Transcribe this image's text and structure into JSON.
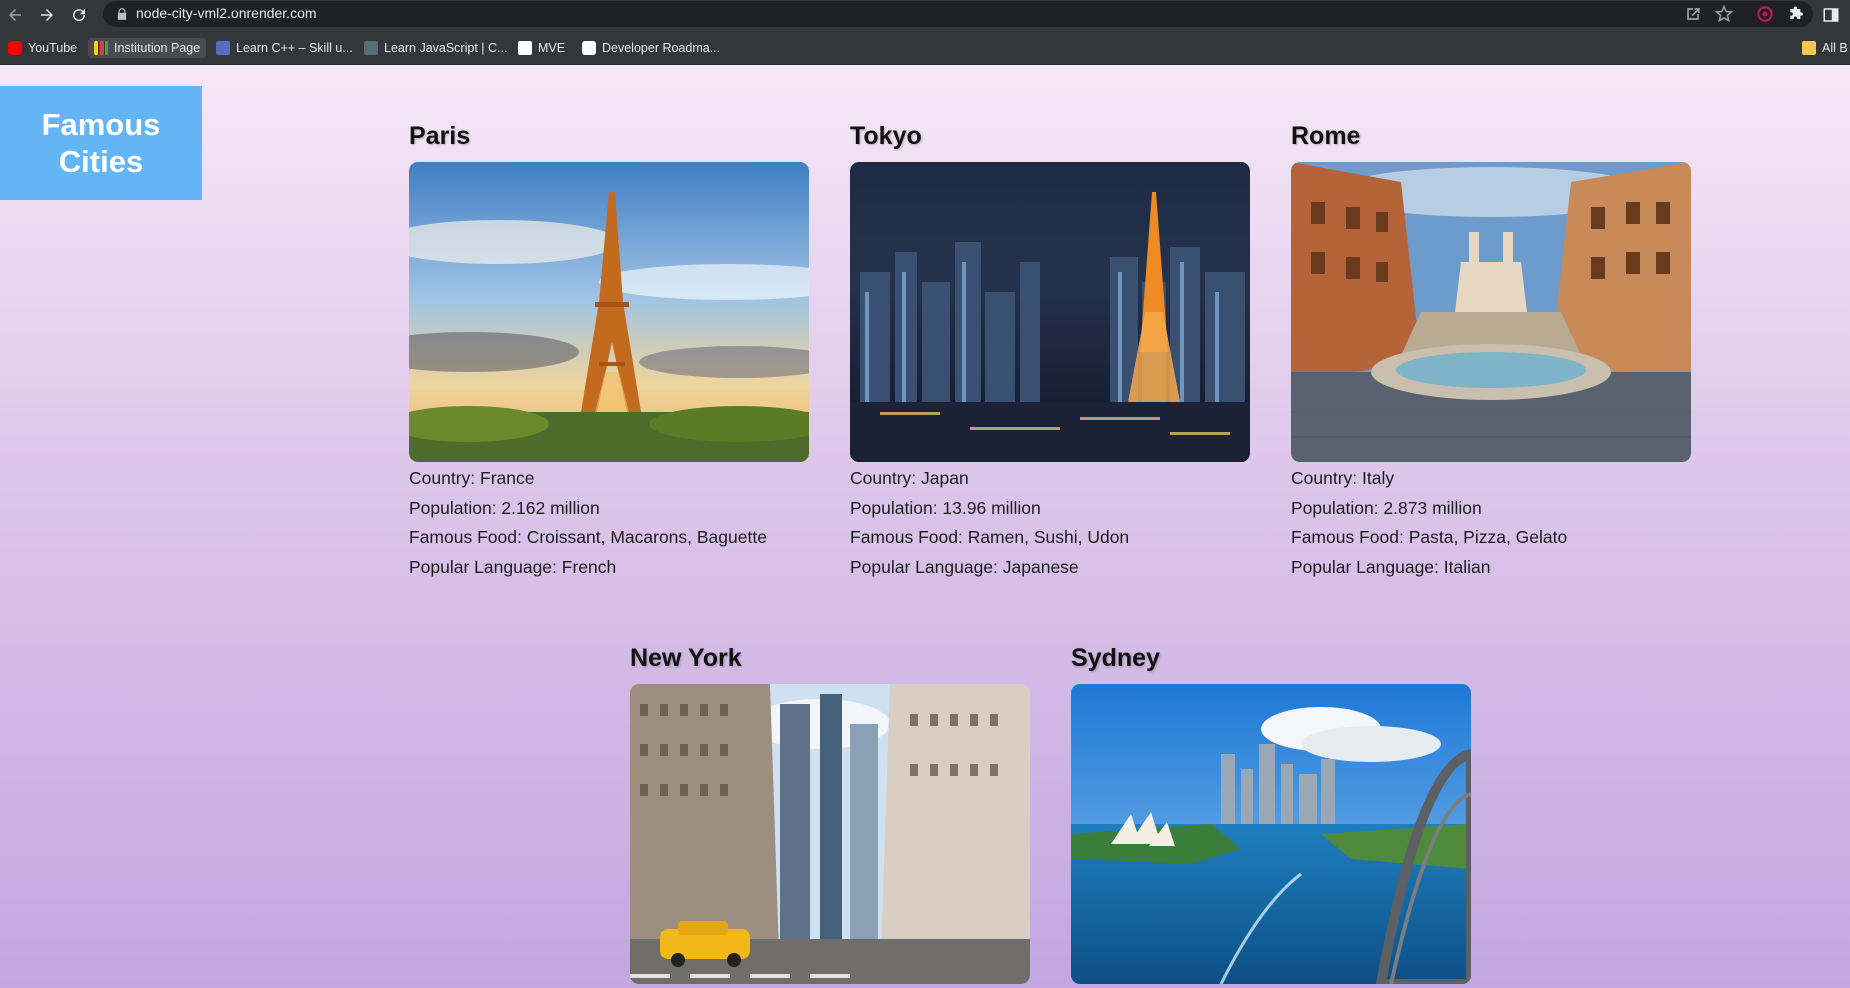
{
  "browser": {
    "url": "node-city-vml2.onrender.com",
    "bookmarks": [
      {
        "label": "YouTube",
        "icon": "youtube-icon",
        "color": "#ff0000"
      },
      {
        "label": "Institution Page",
        "icon": "bar-chart-icon",
        "color": "#ffcc00"
      },
      {
        "label": "Learn C++ – Skill u...",
        "icon": "cpp-icon",
        "color": "#5c6bc0"
      },
      {
        "label": "Learn JavaScript | C...",
        "icon": "doc-icon",
        "color": "#546e7a"
      },
      {
        "label": "MVE",
        "icon": "m-logo-icon",
        "color": "#ffffff"
      },
      {
        "label": "Developer Roadma...",
        "icon": "r-logo-icon",
        "color": "#ffffff"
      }
    ],
    "all_bookmarks": "All B"
  },
  "brand": {
    "title": "Famous Cities",
    "color": "#64b5f6"
  },
  "cities": [
    {
      "name": "Paris",
      "country": "Country: France",
      "population": "Population: 2.162 million",
      "food": "Famous Food: Croissant, Macarons, Baguette",
      "language": "Popular Language: French",
      "photo": "eiffel-tower-photo"
    },
    {
      "name": "Tokyo",
      "country": "Country: Japan",
      "population": "Population: 13.96 million",
      "food": "Famous Food: Ramen, Sushi, Udon",
      "language": "Popular Language: Japanese",
      "photo": "tokyo-night-skyline-photo"
    },
    {
      "name": "Rome",
      "country": "Country: Italy",
      "population": "Population: 2.873 million",
      "food": "Famous Food: Pasta, Pizza, Gelato",
      "language": "Popular Language: Italian",
      "photo": "spanish-steps-fountain-photo"
    },
    {
      "name": "New York",
      "photo": "manhattan-street-photo"
    },
    {
      "name": "Sydney",
      "photo": "sydney-harbour-photo"
    }
  ]
}
